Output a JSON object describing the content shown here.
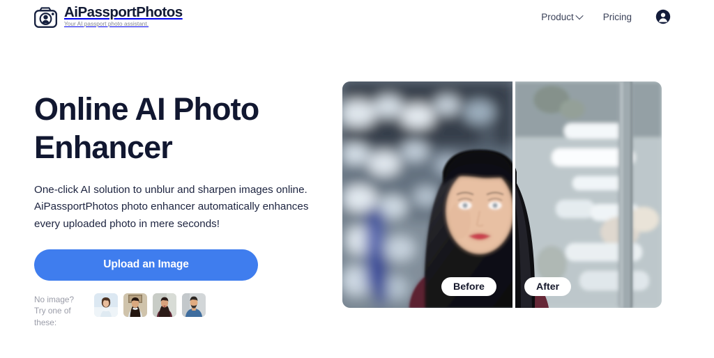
{
  "header": {
    "brand": {
      "icon": "camera-logo-icon",
      "name": "AiPassportPhotos",
      "tagline": "Your AI passport photo assistant."
    },
    "nav": [
      {
        "label": "Product",
        "has_dropdown": true,
        "icon": "chevron-down-icon"
      },
      {
        "label": "Pricing",
        "has_dropdown": false
      }
    ],
    "account": {
      "icon": "account-avatar-icon",
      "label": "Account"
    }
  },
  "hero": {
    "title_line1": "Online AI Photo",
    "title_line2": "Enhancer",
    "subtitle_line1": "One-click AI solution to unblur and sharpen images online.",
    "subtitle_line2": "AiPassportPhotos photo enhancer automatically enhances",
    "subtitle_line3": "every uploaded photo in mere seconds!",
    "upload_button": "Upload an Image",
    "samples_label_line1": "No image?",
    "samples_label_line2": "Try one of",
    "samples_label_line3": "these:",
    "samples": [
      {
        "name": "sample-thumbnail-1",
        "alt": "Woman with short brown hair in light top on pale blue background"
      },
      {
        "name": "sample-thumbnail-2",
        "alt": "Woman with long dark hair on beige wall background"
      },
      {
        "name": "sample-thumbnail-3",
        "alt": "Woman in dark maroon top on grey background"
      },
      {
        "name": "sample-thumbnail-4",
        "alt": "Man with beard in blue shirt on grey background"
      }
    ],
    "comparison": {
      "alt": "Before and after AI enhancement of a portrait of a woman with black bangs in a maroon top",
      "before_label": "Before",
      "after_label": "After"
    }
  },
  "colors": {
    "accent_blue": "#3f7dee",
    "text_dark": "#111730",
    "text_muted": "#9a9ca8",
    "nav_text": "#3a4158",
    "background": "#ffffff",
    "pill_background": "#ffffff"
  }
}
